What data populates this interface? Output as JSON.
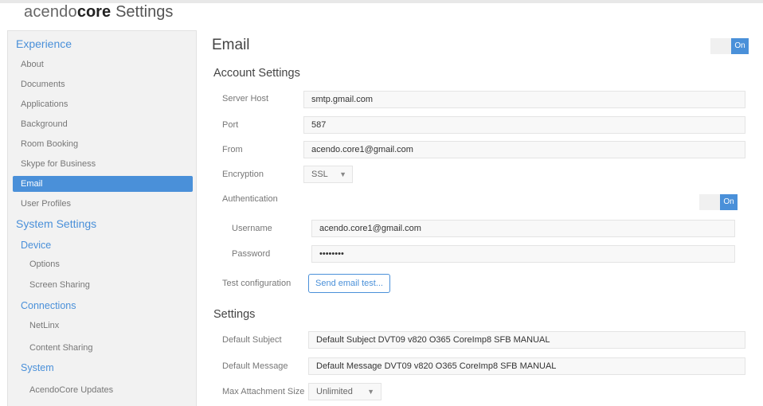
{
  "app": {
    "brand_light": "acendo",
    "brand_bold": "core",
    "title_suffix": "Settings"
  },
  "sidebar": {
    "experience_heading": "Experience",
    "experience_items": [
      "About",
      "Documents",
      "Applications",
      "Background",
      "Room Booking",
      "Skype for Business",
      "Email",
      "User Profiles"
    ],
    "active_item": "Email",
    "system_settings_heading": "System Settings",
    "device_heading": "Device",
    "device_items": [
      "Options",
      "Screen Sharing"
    ],
    "connections_heading": "Connections",
    "connections_items": [
      "NetLinx",
      "Content Sharing"
    ],
    "system_heading": "System",
    "system_items": [
      "AcendoCore Updates"
    ]
  },
  "main": {
    "title": "Email",
    "email_toggle": "On",
    "account_settings": {
      "heading": "Account Settings",
      "server_host_label": "Server Host",
      "server_host_value": "smtp.gmail.com",
      "port_label": "Port",
      "port_value": "587",
      "from_label": "From",
      "from_value": "acendo.core1@gmail.com",
      "encryption_label": "Encryption",
      "encryption_value": "SSL",
      "authentication_label": "Authentication",
      "authentication_toggle": "On",
      "username_label": "Username",
      "username_value": "acendo.core1@gmail.com",
      "password_label": "Password",
      "password_value": "••••••••",
      "test_config_label": "Test configuration",
      "test_button_label": "Send email test..."
    },
    "settings": {
      "heading": "Settings",
      "default_subject_label": "Default Subject",
      "default_subject_value": "Default Subject DVT09 v820 O365 CoreImp8 SFB MANUAL",
      "default_message_label": "Default Message",
      "default_message_value": "Default Message DVT09 v820 O365 CoreImp8 SFB MANUAL",
      "max_attachment_label": "Max Attachment Size",
      "max_attachment_value": "Unlimited"
    }
  },
  "colors": {
    "accent": "#4a90d9",
    "sidebar_bg": "#f2f2f2",
    "input_bg": "#f8f8f8"
  }
}
